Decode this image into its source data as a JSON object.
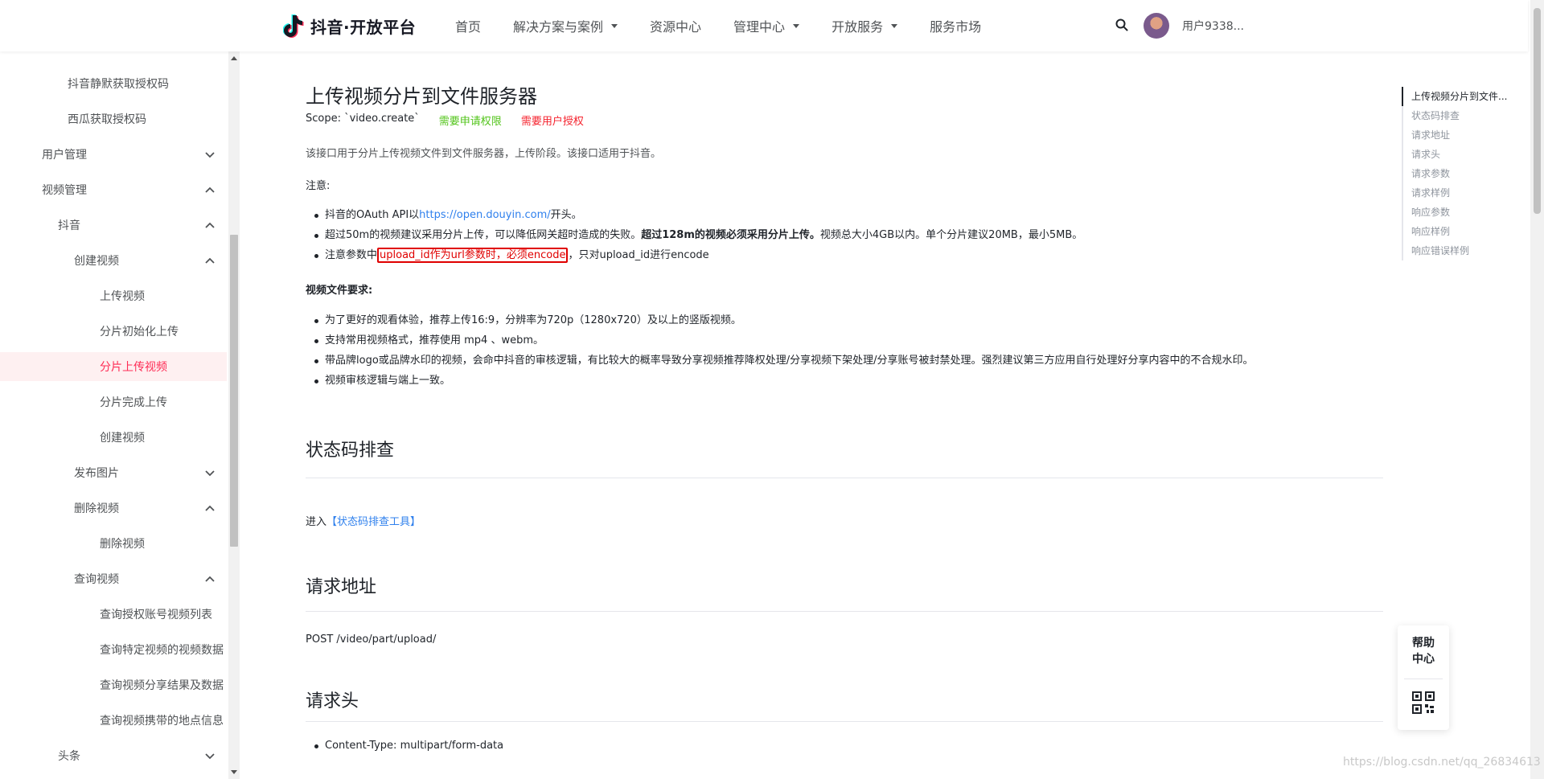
{
  "header": {
    "logo_text": "抖音·开放平台",
    "nav": [
      {
        "label": "首页",
        "has_caret": false
      },
      {
        "label": "解决方案与案例",
        "has_caret": true
      },
      {
        "label": "资源中心",
        "has_caret": false
      },
      {
        "label": "管理中心",
        "has_caret": true
      },
      {
        "label": "开放服务",
        "has_caret": true
      },
      {
        "label": "服务市场",
        "has_caret": false
      }
    ],
    "user_name": "用户9338..."
  },
  "sidebar": {
    "items": [
      {
        "label": "抖音静默获取授权码",
        "indent": 84,
        "chevron": "none"
      },
      {
        "label": "西瓜获取授权码",
        "indent": 84,
        "chevron": "none"
      },
      {
        "label": "用户管理",
        "indent": 52,
        "chevron": "down"
      },
      {
        "label": "视频管理",
        "indent": 52,
        "chevron": "up"
      },
      {
        "label": "抖音",
        "indent": 72,
        "chevron": "up"
      },
      {
        "label": "创建视频",
        "indent": 92,
        "chevron": "up"
      },
      {
        "label": "上传视频",
        "indent": 124,
        "chevron": "none"
      },
      {
        "label": "分片初始化上传",
        "indent": 124,
        "chevron": "none"
      },
      {
        "label": "分片上传视频",
        "indent": 124,
        "chevron": "none",
        "active": true
      },
      {
        "label": "分片完成上传",
        "indent": 124,
        "chevron": "none"
      },
      {
        "label": "创建视频",
        "indent": 124,
        "chevron": "none"
      },
      {
        "label": "发布图片",
        "indent": 92,
        "chevron": "down"
      },
      {
        "label": "删除视频",
        "indent": 92,
        "chevron": "up"
      },
      {
        "label": "删除视频",
        "indent": 124,
        "chevron": "none"
      },
      {
        "label": "查询视频",
        "indent": 92,
        "chevron": "up"
      },
      {
        "label": "查询授权账号视频列表",
        "indent": 124,
        "chevron": "none"
      },
      {
        "label": "查询特定视频的视频数据",
        "indent": 124,
        "chevron": "none"
      },
      {
        "label": "查询视频分享结果及数据",
        "indent": 124,
        "chevron": "none"
      },
      {
        "label": "查询视频携带的地点信息",
        "indent": 124,
        "chevron": "none"
      },
      {
        "label": "头条",
        "indent": 72,
        "chevron": "down"
      }
    ]
  },
  "content": {
    "title": "上传视频分片到文件服务器",
    "scope_text": "Scope: `video.create`",
    "scope_badge_green": "需要申请权限",
    "scope_badge_red": "需要用户授权",
    "intro": "该接口用于分片上传视频文件到文件服务器，上传阶段。该接口适用于抖音。",
    "notice_label": "注意:",
    "notice": {
      "item1_prefix": "抖音的OAuth API以",
      "item1_link": "https://open.douyin.com/",
      "item1_suffix": "开头。",
      "item2_prefix": "超过50m的视频建议采用分片上传，可以降低网关超时造成的失败。",
      "item2_bold": "超过128m的视频必须采用分片上传。",
      "item2_suffix": "视频总大小4GB以内。单个分片建议20MB，最小5MB。",
      "item3_prefix": "注意参数中",
      "item3_highlight": "upload_id作为url参数时，必须encode",
      "item3_suffix": "，只对upload_id进行encode"
    },
    "video_req_label": "视频文件要求:",
    "video_req": [
      "为了更好的观看体验，推荐上传16:9，分辨率为720p（1280x720）及以上的竖版视频。",
      "支持常用视频格式，推荐使用 mp4 、webm。",
      "带品牌logo或品牌水印的视频，会命中抖音的审核逻辑，有比较大的概率导致分享视频推荐降权处理/分享视频下架处理/分享账号被封禁处理。强烈建议第三方应用自行处理好分享内容中的不合规水印。",
      "视频审核逻辑与端上一致。"
    ],
    "h2_status": "状态码排查",
    "status_prefix": "进入",
    "status_link": "【状态码排查工具】",
    "h2_url": "请求地址",
    "url_text": "POST /video/part/upload/",
    "h2_headers": "请求头",
    "header_item": "Content-Type: multipart/form-data"
  },
  "toc": [
    {
      "label": "上传视频分片到文件...",
      "active": true
    },
    {
      "label": "状态码排查"
    },
    {
      "label": "请求地址"
    },
    {
      "label": "请求头"
    },
    {
      "label": "请求参数"
    },
    {
      "label": "请求样例"
    },
    {
      "label": "响应参数"
    },
    {
      "label": "响应样例"
    },
    {
      "label": "响应错误样例"
    }
  ],
  "float": {
    "help_line1": "帮助",
    "help_line2": "中心"
  },
  "watermark": "https://blog.csdn.net/qq_26834613",
  "colors": {
    "accent": "#fe2c55",
    "link": "#2f80ed",
    "green": "#52c41a",
    "red": "#f5222d"
  }
}
